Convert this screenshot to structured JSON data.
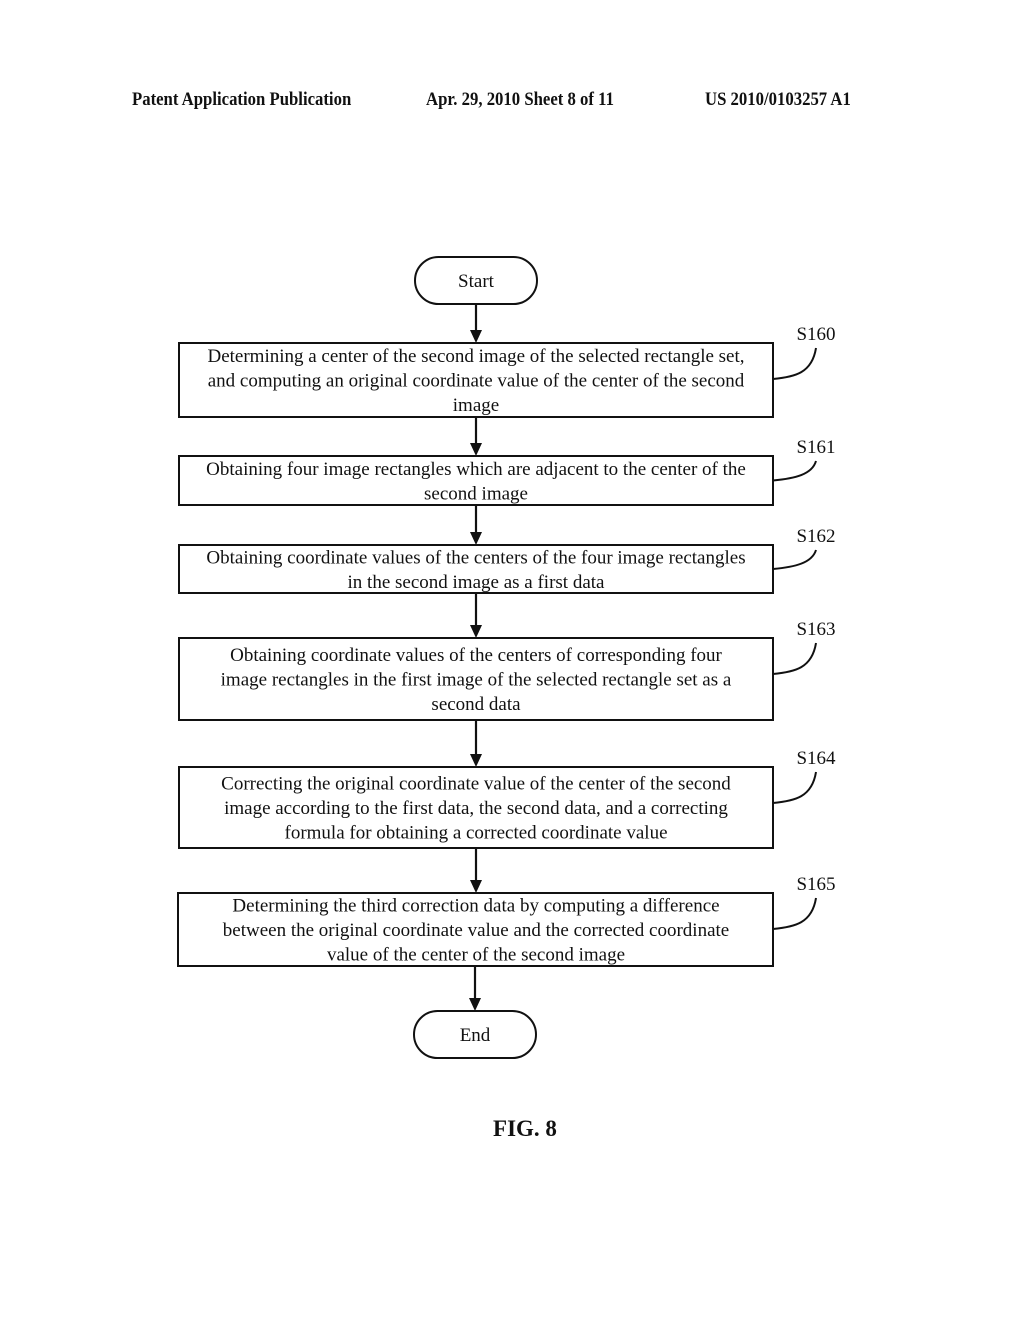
{
  "header": {
    "left": "Patent Application Publication",
    "middle": "Apr. 29, 2010  Sheet 8 of 11",
    "right": "US 2010/0103257 A1"
  },
  "flowchart": {
    "start_label": "Start",
    "end_label": "End",
    "steps": [
      {
        "id": "S160",
        "lines": [
          "Determining a center of the second image of the selected rectangle set,",
          "and computing an original coordinate value of the center of the second",
          "image"
        ]
      },
      {
        "id": "S161",
        "lines": [
          "Obtaining four image rectangles which are adjacent to the center of the",
          "second image"
        ]
      },
      {
        "id": "S162",
        "lines": [
          "Obtaining coordinate values of the centers of the four image rectangles",
          "in the second image as a first data"
        ]
      },
      {
        "id": "S163",
        "lines": [
          "Obtaining coordinate values of the centers of corresponding four",
          "image rectangles in the first image of the selected rectangle set as a",
          "second data"
        ]
      },
      {
        "id": "S164",
        "lines": [
          "Correcting the original coordinate value of the center of the second",
          "image according to the first data, the second data, and a correcting",
          "formula for obtaining a corrected coordinate value"
        ]
      },
      {
        "id": "S165",
        "lines": [
          "Determining the third correction data by computing a difference",
          "between the original coordinate value and the corrected coordinate",
          "value of the center of the second image"
        ]
      }
    ]
  },
  "figure_caption": "FIG. 8"
}
